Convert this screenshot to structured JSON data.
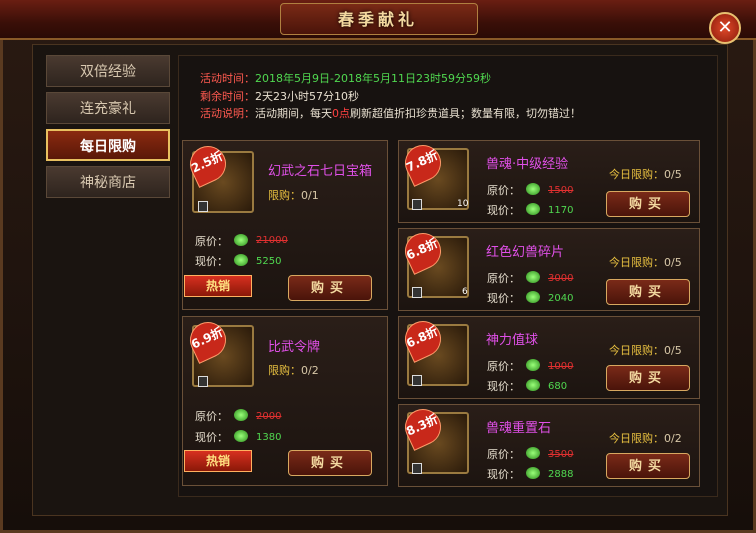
{
  "window": {
    "title": "春季献礼",
    "close_icon": "close-icon"
  },
  "sidebar": {
    "items": [
      {
        "label": "双倍经验",
        "active": false
      },
      {
        "label": "连充豪礼",
        "active": false
      },
      {
        "label": "每日限购",
        "active": true
      },
      {
        "label": "神秘商店",
        "active": false
      }
    ]
  },
  "info": {
    "time_label": "活动时间：",
    "time_value": "2018年5月9日-2018年5月11日23时59分59秒",
    "remain_label": "剩余时间：",
    "remain_value": "2天23小时57分10秒",
    "desc_label": "活动说明：",
    "desc_pre": "活动期间，每天",
    "desc_hl": "0点",
    "desc_post": "刷新超值折扣珍贵道具；数量有限，切勿错过！"
  },
  "labels": {
    "original": "原价：",
    "current": "现价：",
    "limit": "限购：",
    "today_limit": "今日限购：",
    "buy": "购买",
    "hot": "热销"
  },
  "items": [
    {
      "discount": "2.5折",
      "name": "幻武之石七日宝箱",
      "limit": "0/1",
      "original": "21000",
      "current": "5250",
      "count": ""
    },
    {
      "discount": "6.9折",
      "name": "比武令牌",
      "limit": "0/2",
      "original": "2000",
      "current": "1380",
      "count": ""
    },
    {
      "discount": "7.8折",
      "name": "兽魂·中级经验",
      "limit": "0/5",
      "original": "1500",
      "current": "1170",
      "count": "10"
    },
    {
      "discount": "6.8折",
      "name": "红色幻兽碎片",
      "limit": "0/5",
      "original": "3000",
      "current": "2040",
      "count": "6"
    },
    {
      "discount": "6.8折",
      "name": "神力值球",
      "limit": "0/5",
      "original": "1000",
      "current": "680",
      "count": ""
    },
    {
      "discount": "8.3折",
      "name": "兽魂重置石",
      "limit": "0/2",
      "original": "3500",
      "current": "2888",
      "count": ""
    }
  ]
}
